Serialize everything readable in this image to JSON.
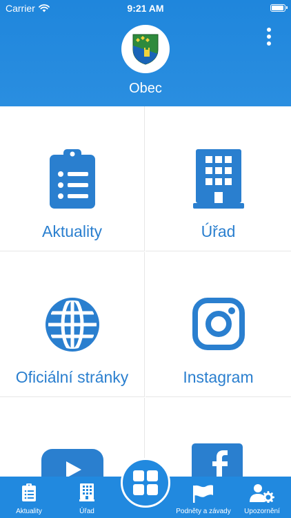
{
  "status": {
    "carrier": "Carrier",
    "time": "9:21 AM",
    "battery_level": 0.95
  },
  "header": {
    "title": "Obec"
  },
  "colors": {
    "primary": "#2189df",
    "tile_icon": "#2a7fcf",
    "label": "#2a7fcf",
    "divider": "#e6e6e6"
  },
  "tiles": [
    {
      "label": "Aktuality",
      "icon": "clipboard-list-icon"
    },
    {
      "label": "Úřad",
      "icon": "building-icon"
    },
    {
      "label": "Oficiální stránky",
      "icon": "globe-icon"
    },
    {
      "label": "Instagram",
      "icon": "instagram-icon"
    },
    {
      "label": "",
      "icon": "youtube-icon"
    },
    {
      "label": "",
      "icon": "facebook-icon"
    }
  ],
  "tabbar": {
    "items": [
      {
        "label": "Aktuality",
        "icon": "clipboard-list-icon"
      },
      {
        "label": "Úřad",
        "icon": "building-icon"
      },
      {
        "label": "",
        "icon": "grid-icon"
      },
      {
        "label": "Podněty a závady",
        "icon": "flag-icon"
      },
      {
        "label": "Upozornění",
        "icon": "user-gear-icon"
      }
    ]
  }
}
